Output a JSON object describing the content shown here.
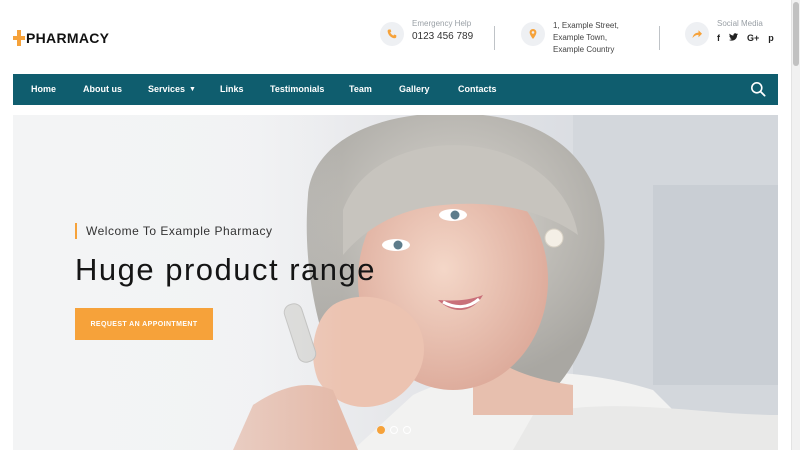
{
  "brand": {
    "logo_text": "PHARMACY",
    "accent_color": "#f6a23a",
    "nav_color": "#0f5d6e"
  },
  "header": {
    "emergency": {
      "label": "Emergency Help",
      "value": "0123 456 789",
      "icon": "phone-icon"
    },
    "address": {
      "lines": [
        "1, Example Street,",
        "Example Town,",
        "Example Country"
      ],
      "icon": "map-pin-icon"
    },
    "social": {
      "label": "Social Media",
      "icon": "share-icon",
      "items": [
        "f",
        "t",
        "G+",
        "p"
      ]
    }
  },
  "nav": {
    "items": [
      {
        "label": "Home"
      },
      {
        "label": "About us"
      },
      {
        "label": "Services",
        "dropdown": true
      },
      {
        "label": "Links"
      },
      {
        "label": "Testimonials"
      },
      {
        "label": "Team"
      },
      {
        "label": "Gallery"
      },
      {
        "label": "Contacts"
      }
    ],
    "search_icon": "search-icon"
  },
  "hero": {
    "welcome": "Welcome To Example Pharmacy",
    "headline": "Huge product range",
    "cta_label": "REQUEST AN APPOINTMENT",
    "slides_total": 3,
    "active_slide": 1
  }
}
